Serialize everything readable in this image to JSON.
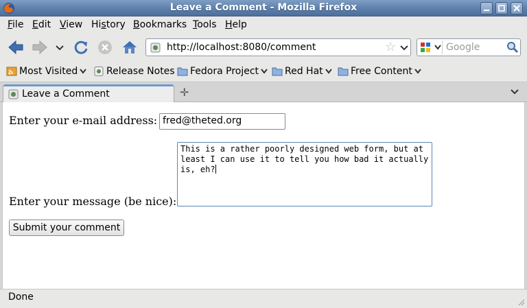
{
  "window": {
    "title": "Leave a Comment - Mozilla Firefox"
  },
  "menu": {
    "items": [
      {
        "label": "File",
        "u": "F",
        "rest": "ile"
      },
      {
        "label": "Edit",
        "u": "E",
        "rest": "dit"
      },
      {
        "label": "View",
        "u": "V",
        "rest": "iew"
      },
      {
        "label": "History",
        "pre": "Hi",
        "u": "s",
        "rest": "tory"
      },
      {
        "label": "Bookmarks",
        "u": "B",
        "rest": "ookmarks"
      },
      {
        "label": "Tools",
        "u": "T",
        "rest": "ools"
      },
      {
        "label": "Help",
        "u": "H",
        "rest": "elp"
      }
    ]
  },
  "navigation": {
    "url": "http://localhost:8080/comment",
    "search_placeholder": "Google"
  },
  "bookmarks": [
    {
      "label": "Most Visited",
      "icon": "rss-icon"
    },
    {
      "label": "Release Notes",
      "icon": "page-icon"
    },
    {
      "label": "Fedora Project",
      "icon": "folder-icon"
    },
    {
      "label": "Red Hat",
      "icon": "folder-icon"
    },
    {
      "label": "Free Content",
      "icon": "folder-icon"
    }
  ],
  "tab": {
    "label": "Leave a Comment"
  },
  "form": {
    "email_label": "Enter your e-mail address:",
    "email_value": "fred@theted.org",
    "message_label": "Enter your message (be nice):",
    "message_value": "This is a rather poorly designed web form, but at\nleast I can use it to tell you how bad it actually\nis, eh?",
    "submit_label": "Submit your comment"
  },
  "status": {
    "text": "Done"
  },
  "colors": {
    "titlebar": "#5d7fab",
    "accent_tab": "#6d9ad0",
    "textarea_focus": "#5a86b6"
  }
}
